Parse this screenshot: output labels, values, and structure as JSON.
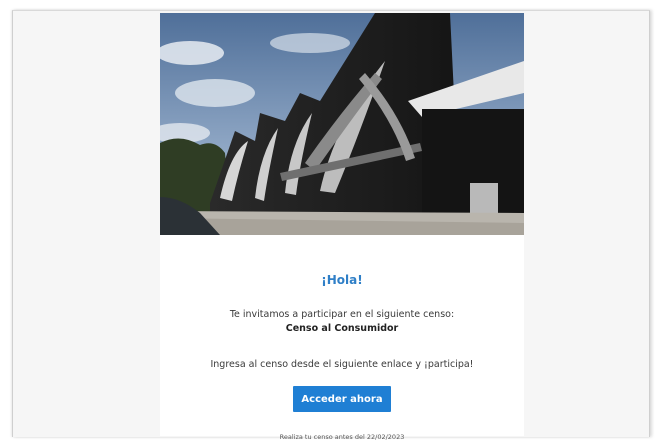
{
  "email": {
    "hero_alt": "Edificio con mural de arte abstracto",
    "greeting": "¡Hola!",
    "invite_text": "Te invitamos a participar en el siguiente censo:",
    "census_name": "Censo al Consumidor",
    "link_text": "Ingresa al censo desde el siguiente enlace y ¡participa!",
    "cta_label": "Acceder ahora",
    "deadline": "Realiza tu censo antes del 22/02/2023"
  },
  "colors": {
    "accent": "#2f7fc7",
    "button": "#1f7fd4",
    "background": "#f6f6f6"
  }
}
